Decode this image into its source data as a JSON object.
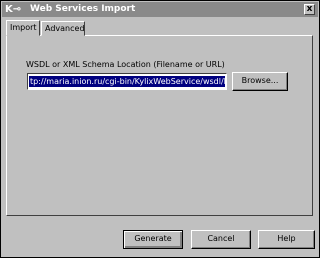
{
  "window": {
    "icon_glyph": "K⊸",
    "title": "Web Services Import",
    "close_glyph": "x"
  },
  "tabs": [
    {
      "label": "Import",
      "active": true
    },
    {
      "label": "Advanced",
      "active": false
    }
  ],
  "import_tab": {
    "location_label": "WSDL or XML Schema Location (Filename or URL)",
    "location_value": "tp://maria.inion.ru/cgi-bin/KylixWebService/wsdl/ITrLiter",
    "browse_label": "Browse..."
  },
  "footer": {
    "generate_label": "Generate",
    "cancel_label": "Cancel",
    "help_label": "Help"
  },
  "colors": {
    "title_bg": "#8a8a8a",
    "selection_bg": "#000080",
    "face": "#c0c0c0"
  }
}
